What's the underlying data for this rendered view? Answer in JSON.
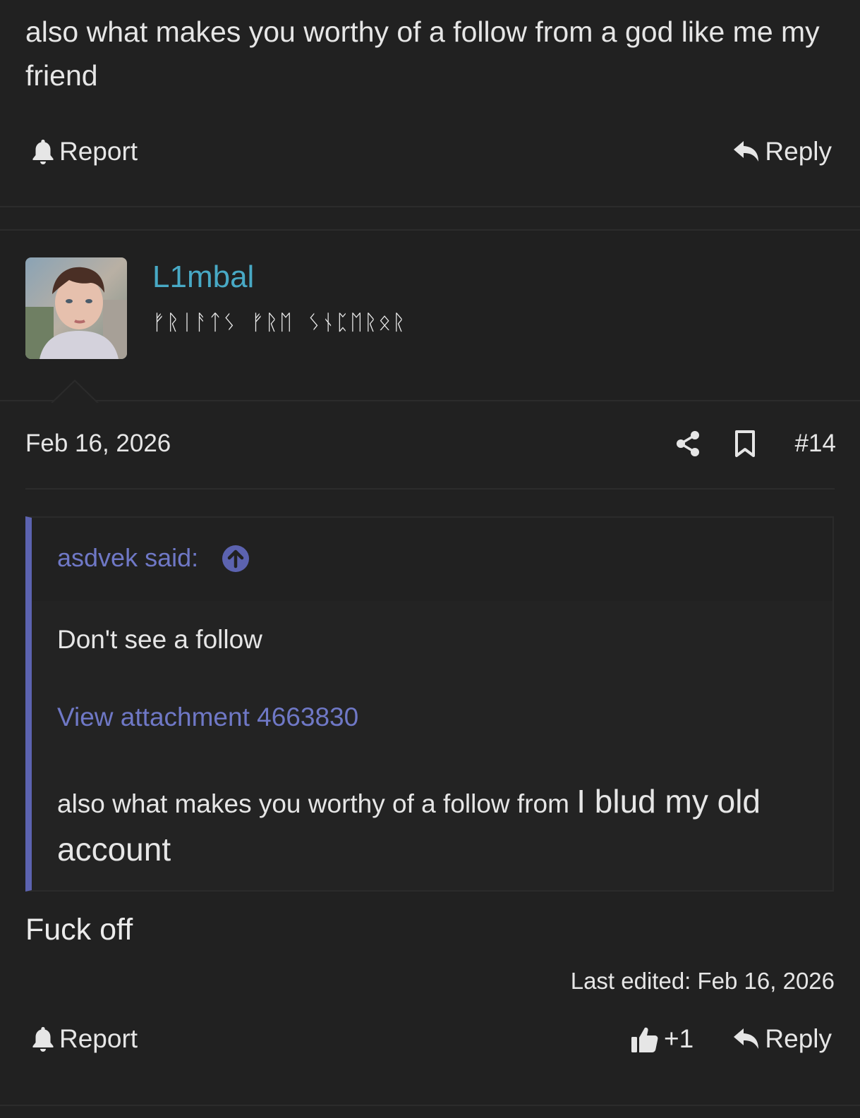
{
  "previous_post": {
    "text": "also what makes you worthy of a follow from a god like me my friend",
    "report_label": "Report",
    "reply_label": "Reply"
  },
  "post": {
    "username": "L1mbal",
    "user_title": "ᚠᚱᛁᚨᛏᛊ ᚠᚱᛖ ᛊᚾᛈᛖᚱᛟᚱ",
    "date": "Feb 16, 2026",
    "post_number": "#14",
    "quote": {
      "author": "asdvek said:",
      "line1": "Don't see a follow",
      "attachment_link": "View attachment 4663830",
      "line3_small": "also what makes you worthy of a follow from ",
      "line3_big": "I blud my old account"
    },
    "body": "Fuck off",
    "last_edited": "Last edited: Feb 16, 2026",
    "report_label": "Report",
    "like_count": "+1",
    "reply_label": "Reply"
  },
  "icons": {
    "report": "bell-icon",
    "reply": "reply-arrow-icon",
    "share": "share-icon",
    "bookmark": "bookmark-icon",
    "quote_jump": "arrow-up-circle-icon",
    "like": "thumbs-up-icon"
  },
  "colors": {
    "background": "#212121",
    "username": "#48a9c5",
    "quote_accent": "#5c63b0",
    "link": "#6f78c6"
  }
}
